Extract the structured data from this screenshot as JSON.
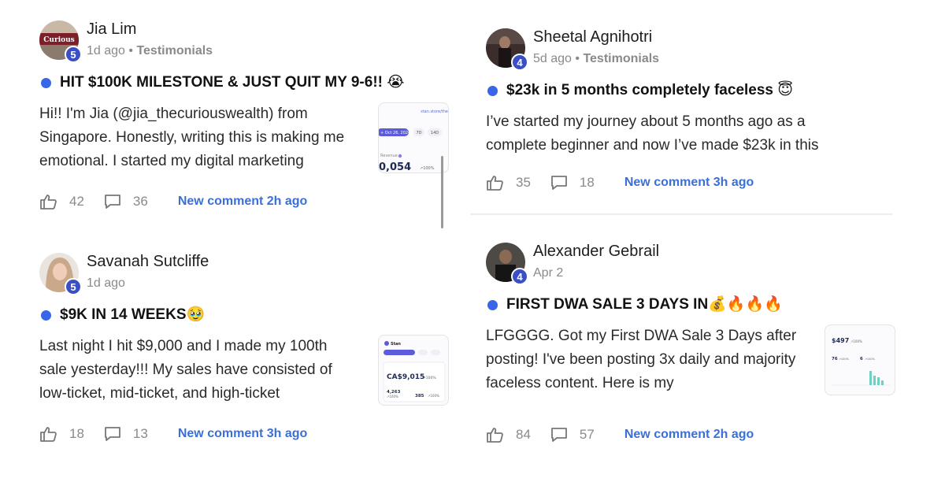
{
  "posts": [
    {
      "author": "Jia Lim",
      "level": "5",
      "time": "1d ago",
      "category": "Testimonials",
      "title": "HIT $100K MILESTONE & JUST QUIT MY 9-6!! 😭",
      "excerpt": "Hi!! I'm Jia (@jia_thecuriouswealth) from Singapore. Honestly, writing this is making me emotional. I started my digital marketing",
      "likes": "42",
      "comments": "36",
      "new_comment": "New comment 2h ago",
      "avatar_text": "Curious",
      "thumb": {
        "url": "stan.store/the",
        "date": "+ Oct 26, 2024",
        "chip1": "7D",
        "chip2": "14D",
        "label": "Revenue",
        "value": "0,054",
        "change": "↗100%"
      }
    },
    {
      "author": "Sheetal Agnihotri",
      "level": "4",
      "time": "5d ago",
      "category": "Testimonials",
      "title": "$23k in 5 months completely faceless 😇",
      "excerpt": "I’ve started my journey about 5 months ago as a complete beginner and now I’ve made $23k in this",
      "likes": "35",
      "comments": "18",
      "new_comment": "New comment 3h ago"
    },
    {
      "author": "Savanah Sutcliffe",
      "level": "5",
      "time": "1d ago",
      "category": "",
      "title": "$9K IN 14 WEEKS🥹",
      "excerpt": "Last night I hit $9,000 and I made my 100th sale yesterday!!! My sales have consisted of low-ticket, mid-ticket, and high-ticket",
      "likes": "18",
      "comments": "13",
      "new_comment": "New comment 3h ago",
      "thumb": {
        "brand": "Stan",
        "value": "CA$9,015",
        "change": "↗100%",
        "v2": "4,263",
        "v3": "385",
        "c2": "↗100%",
        "c3": "↗100%"
      }
    },
    {
      "author": "Alexander Gebrail",
      "level": "4",
      "time": "Apr 2",
      "category": "",
      "title": "FIRST DWA SALE 3 DAYS IN💰🔥🔥🔥",
      "excerpt": "LFGGGG. Got my First DWA Sale 3 Days after posting! I've been posting 3x daily and majority faceless content. Here is my",
      "likes": "84",
      "comments": "57",
      "new_comment": "New comment 2h ago",
      "thumb": {
        "value": "$497",
        "change": "↗100%",
        "v2": "76",
        "v3": "6",
        "c2": "↗100%",
        "c3": "↗100%"
      }
    }
  ],
  "colors": {
    "accent": "#3766e8",
    "link": "#3b6fd8",
    "badge": "#3b4fc4",
    "muted": "#8a8a8a"
  },
  "icons": {
    "like": "thumbs-up-icon",
    "comment": "comment-bubble-icon"
  }
}
